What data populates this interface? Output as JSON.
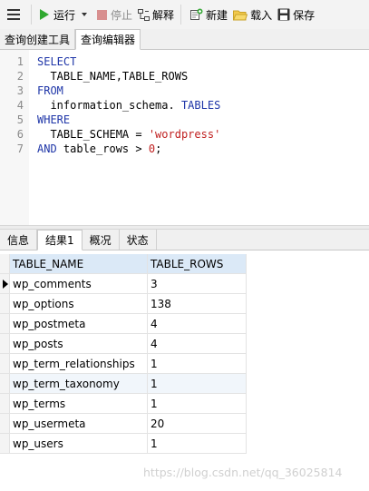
{
  "toolbar": {
    "menu_icon": "hamburger-icon",
    "run_label": "运行",
    "stop_label": "停止",
    "explain_label": "解释",
    "new_label": "新建",
    "load_label": "载入",
    "save_label": "保存"
  },
  "editor_tabs": [
    "查询创建工具",
    "查询编辑器"
  ],
  "code_lines": [
    {
      "n": "1",
      "parts": [
        {
          "t": "SELECT",
          "c": "kw"
        }
      ]
    },
    {
      "n": "2",
      "parts": [
        {
          "t": "  TABLE_NAME,TABLE_ROWS",
          "c": ""
        }
      ]
    },
    {
      "n": "3",
      "parts": [
        {
          "t": "FROM",
          "c": "kw"
        }
      ]
    },
    {
      "n": "4",
      "parts": [
        {
          "t": "  information_schema. ",
          "c": ""
        },
        {
          "t": "TABLES",
          "c": "kw"
        }
      ]
    },
    {
      "n": "5",
      "parts": [
        {
          "t": "WHERE",
          "c": "kw"
        }
      ]
    },
    {
      "n": "6",
      "parts": [
        {
          "t": "  TABLE_SCHEMA = ",
          "c": ""
        },
        {
          "t": "'wordpress'",
          "c": "str"
        }
      ]
    },
    {
      "n": "7",
      "parts": [
        {
          "t": "AND",
          "c": "kw"
        },
        {
          "t": " table_rows > ",
          "c": ""
        },
        {
          "t": "0",
          "c": "num"
        },
        {
          "t": ";",
          "c": ""
        }
      ]
    }
  ],
  "result_tabs": [
    "信息",
    "结果1",
    "概况",
    "状态"
  ],
  "grid": {
    "columns": [
      "TABLE_NAME",
      "TABLE_ROWS"
    ],
    "rows": [
      [
        "wp_comments",
        "3"
      ],
      [
        "wp_options",
        "138"
      ],
      [
        "wp_postmeta",
        "4"
      ],
      [
        "wp_posts",
        "4"
      ],
      [
        "wp_term_relationships",
        "1"
      ],
      [
        "wp_term_taxonomy",
        "1"
      ],
      [
        "wp_terms",
        "1"
      ],
      [
        "wp_usermeta",
        "20"
      ],
      [
        "wp_users",
        "1"
      ]
    ]
  },
  "watermark": "https://blog.csdn.net/qq_36025814",
  "colors": {
    "keyword": "#1f36a8",
    "string": "#c02020",
    "run_green": "#2fa82f",
    "header_blue": "#dbe9f7"
  }
}
